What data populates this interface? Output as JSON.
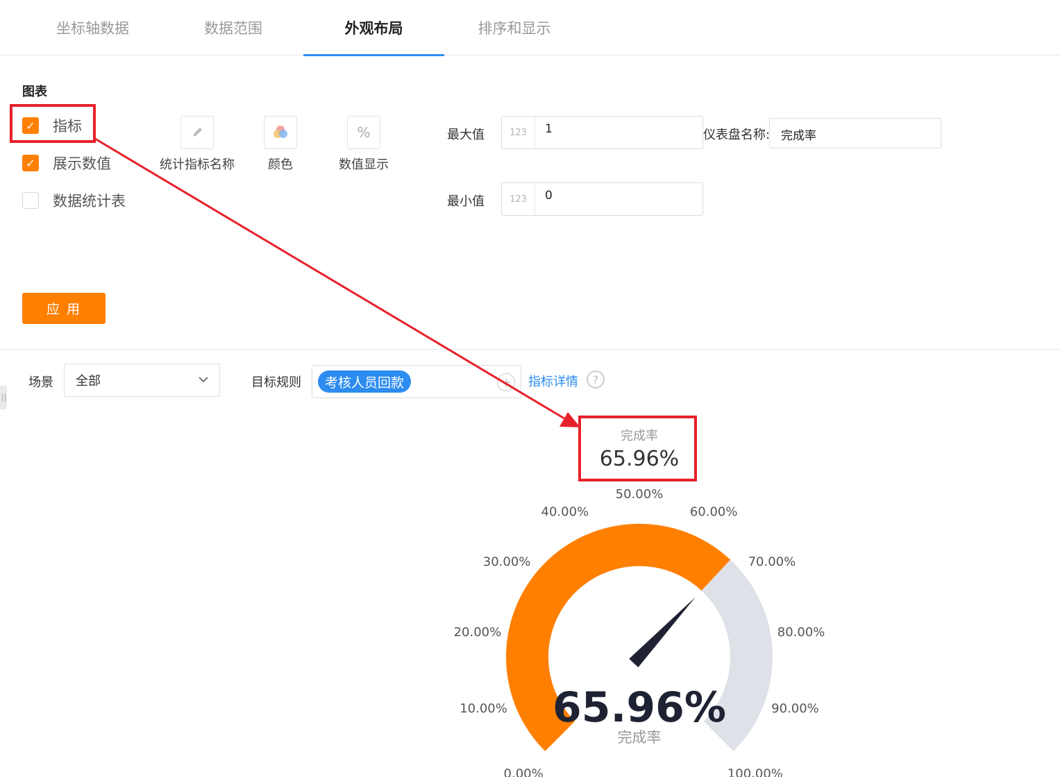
{
  "tabs": [
    {
      "label": "坐标轴数据",
      "active": false
    },
    {
      "label": "数据范围",
      "active": false
    },
    {
      "label": "外观布局",
      "active": true
    },
    {
      "label": "排序和显示",
      "active": false
    }
  ],
  "chart_section": {
    "title": "图表"
  },
  "options": [
    {
      "label": "指标",
      "checked": true
    },
    {
      "label": "展示数值",
      "checked": true
    },
    {
      "label": "数据统计表",
      "checked": false
    }
  ],
  "tools": [
    {
      "label": "统计指标名称",
      "icon": "pencil-icon"
    },
    {
      "label": "颜色",
      "icon": "color-circles-icon"
    },
    {
      "label": "数值显示",
      "icon": "percent-icon",
      "glyph": "%"
    }
  ],
  "fields": {
    "max_label": "最大值",
    "max_prefix": "123",
    "max_value": "1",
    "min_label": "最小值",
    "min_prefix": "123",
    "min_value": "0",
    "gauge_name_label": "仪表盘名称:",
    "gauge_name_value": "完成率"
  },
  "apply_label": "应 用",
  "filters": {
    "scene_label": "场景",
    "scene_value": "全部",
    "target_label": "目标规则",
    "target_tag": "考核人员回款",
    "detail_link": "指标详情",
    "help_glyph": "?"
  },
  "indicator": {
    "name": "完成率",
    "value": "65.96%"
  },
  "colors": {
    "accent": "#ff7f00",
    "link": "#2d8cf0",
    "annotation": "#e8202a",
    "gauge_track": "#dfe1e8"
  },
  "chart_data": {
    "type": "gauge",
    "value": 0.6596,
    "min": 0,
    "max": 1,
    "value_label": "65.96%",
    "name": "完成率",
    "tick_labels": [
      "0.00%",
      "10.00%",
      "20.00%",
      "30.00%",
      "40.00%",
      "50.00%",
      "60.00%",
      "70.00%",
      "80.00%",
      "90.00%",
      "100.00%"
    ],
    "progress_color": "#ff7f00",
    "track_color": "#dfe1e8"
  }
}
